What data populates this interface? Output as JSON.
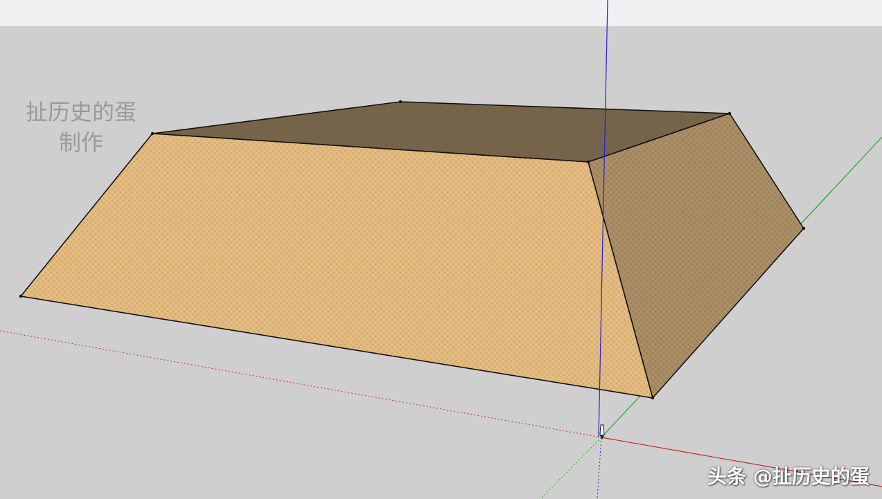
{
  "canvas": {
    "sky_color": "#eef0f2",
    "ground_color": "#cfcfcf"
  },
  "model": {
    "top_face_color": "#76644a",
    "front_face_color": "#e2b97e",
    "side_face_color": "#a88c64",
    "edge_color": "#111111"
  },
  "axes": {
    "red_axis_color": "#cc2222",
    "green_axis_color": "#22aa22",
    "blue_axis_color": "#2222cc"
  },
  "credit": {
    "line1": "扯历史的蛋",
    "line2": "制作"
  },
  "watermark": {
    "text": "头条 @扯历史的蛋"
  },
  "cursor": {
    "icon": "pencil-cursor-icon"
  }
}
